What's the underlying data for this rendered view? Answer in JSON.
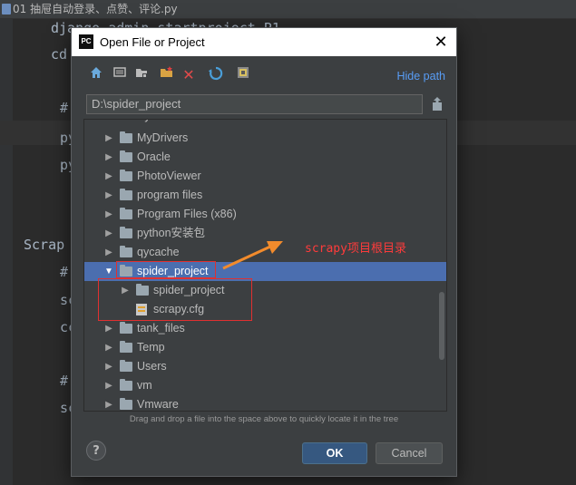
{
  "editor": {
    "tab_label": "01 抽屉自动登录、点赞、评论.py",
    "lines": [
      "django-admin startproject P1",
      "cd",
      "#",
      "py",
      "py",
      "Scrap",
      "#",
      "sc",
      "cc",
      "#",
      "sc"
    ]
  },
  "dialog": {
    "title": "Open File or Project",
    "logo_text": "PC",
    "close_icon": "close-icon",
    "hide_path_label": "Hide path",
    "path_value": "D:\\spider_project",
    "tree_cutoff_item": "myDownloads",
    "tree": [
      {
        "label": "MyDrivers",
        "arrow": "▶",
        "indent": 0,
        "type": "folder"
      },
      {
        "label": "Oracle",
        "arrow": "▶",
        "indent": 0,
        "type": "folder"
      },
      {
        "label": "PhotoViewer",
        "arrow": "▶",
        "indent": 0,
        "type": "folder"
      },
      {
        "label": "program files",
        "arrow": "▶",
        "indent": 0,
        "type": "folder"
      },
      {
        "label": "Program Files (x86)",
        "arrow": "▶",
        "indent": 0,
        "type": "folder"
      },
      {
        "label": "python安装包",
        "arrow": "▶",
        "indent": 0,
        "type": "folder"
      },
      {
        "label": "qycache",
        "arrow": "▶",
        "indent": 0,
        "type": "folder"
      },
      {
        "label": "spider_project",
        "arrow": "▼",
        "indent": 0,
        "type": "folder",
        "selected": true
      },
      {
        "label": "spider_project",
        "arrow": "▶",
        "indent": 1,
        "type": "folder"
      },
      {
        "label": "scrapy.cfg",
        "arrow": "",
        "indent": 1,
        "type": "cfg"
      },
      {
        "label": "tank_files",
        "arrow": "▶",
        "indent": 0,
        "type": "folder"
      },
      {
        "label": "Temp",
        "arrow": "▶",
        "indent": 0,
        "type": "folder"
      },
      {
        "label": "Users",
        "arrow": "▶",
        "indent": 0,
        "type": "folder"
      },
      {
        "label": "vm",
        "arrow": "▶",
        "indent": 0,
        "type": "folder"
      },
      {
        "label": "Vmware",
        "arrow": "▶",
        "indent": 0,
        "type": "folder"
      }
    ],
    "hint": "Drag and drop a file into the space above to quickly locate it in the tree",
    "help_label": "?",
    "ok_label": "OK",
    "cancel_label": "Cancel"
  },
  "annotation": {
    "text": "scrapy项目根目录",
    "color": "#ff3b3b"
  },
  "colors": {
    "selection": "#4b6eaf",
    "link": "#589df6",
    "ok_button": "#365880"
  }
}
